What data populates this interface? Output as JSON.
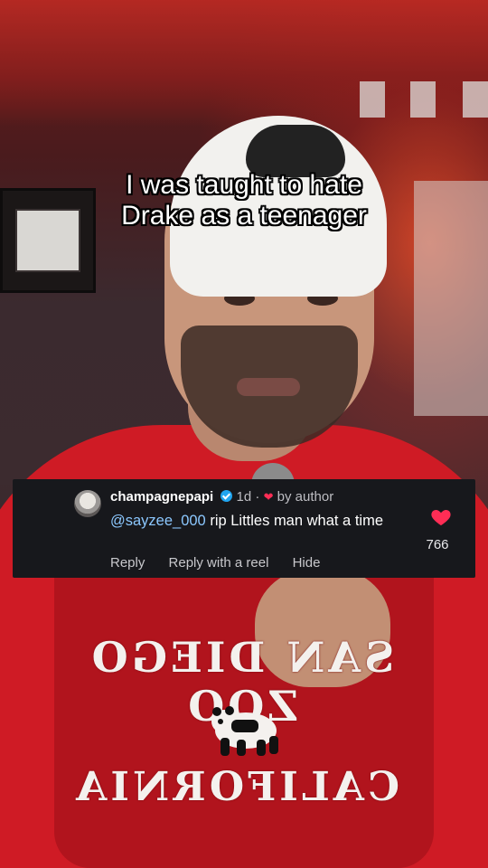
{
  "caption": {
    "line1": "I was taught to hate",
    "line2": "Drake as a teenager"
  },
  "comment": {
    "username": "champagnepapi",
    "time": "1d",
    "dot": "·",
    "liked_by": "by author",
    "mention": "@sayzee_000",
    "text": " rip Littles man what a time",
    "like_count": "766",
    "actions": {
      "reply": "Reply",
      "reply_reel": "Reply with a reel",
      "hide": "Hide"
    }
  },
  "sweatshirt": {
    "top_text": "SAN DIEGO ZOO",
    "bottom_text": "CALIFORNIA"
  },
  "colors": {
    "like_red": "#ff2d55",
    "verified_blue": "#20a5f0",
    "card_bg": "#17181c"
  }
}
